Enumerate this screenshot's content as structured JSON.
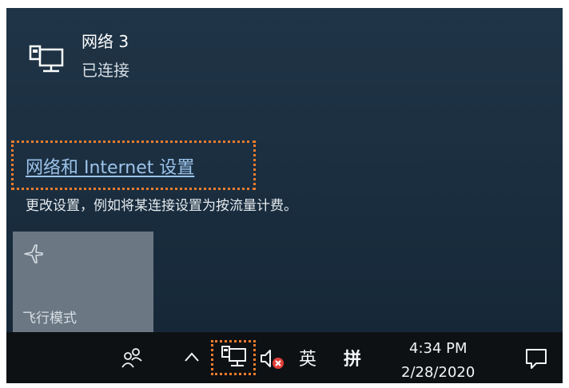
{
  "network": {
    "name": "网络 3",
    "status": "已连接"
  },
  "settings": {
    "link_label": "网络和 Internet 设置",
    "description": "更改设置，例如将某连接设置为按流量计费。"
  },
  "quick_actions": [
    {
      "label": "飞行模式",
      "icon": "airplane-icon",
      "state": "off"
    }
  ],
  "taskbar": {
    "icons": [
      "people-icon",
      "show-hidden-icons-chevron",
      "network-icon",
      "volume-muted-icon",
      "action-center-icon"
    ],
    "language": "英",
    "ime": "拼",
    "time": "4:34 PM",
    "date": "2/28/2020"
  },
  "colors": {
    "flyout_bg": "#1b2f41",
    "link": "#9cc3ea",
    "tile_bg": "#6b7884",
    "taskbar_bg": "#0e1114",
    "highlight": "#f07c2c",
    "mute_badge": "#e0403a"
  }
}
